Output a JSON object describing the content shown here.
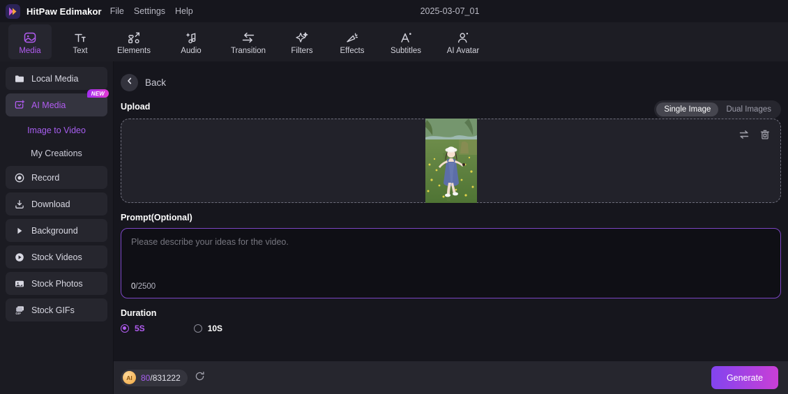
{
  "titlebar": {
    "app_title": "HitPaw Edimakor",
    "menus": [
      "File",
      "Settings",
      "Help"
    ],
    "project_name": "2025-03-07_01",
    "logo_icon": "hitpaw-play-logo-icon"
  },
  "toolbar": {
    "tabs": [
      {
        "label": "Media",
        "icon": "media-image-icon",
        "active": true
      },
      {
        "label": "Text",
        "icon": "text-icon",
        "active": false
      },
      {
        "label": "Elements",
        "icon": "elements-shapes-icon",
        "active": false
      },
      {
        "label": "Audio",
        "icon": "audio-note-icon",
        "active": false
      },
      {
        "label": "Transition",
        "icon": "transition-arrows-icon",
        "active": false
      },
      {
        "label": "Filters",
        "icon": "filters-sparkle-icon",
        "active": false
      },
      {
        "label": "Effects",
        "icon": "effects-magic-wand-icon",
        "active": false
      },
      {
        "label": "Subtitles",
        "icon": "subtitles-letter-a-icon",
        "active": false
      },
      {
        "label": "AI Avatar",
        "icon": "ai-avatar-person-icon",
        "active": false
      }
    ]
  },
  "sidebar": {
    "items": [
      {
        "label": "Local Media",
        "icon": "folder-icon",
        "type": "item",
        "active": false
      },
      {
        "label": "AI Media",
        "icon": "ai-media-icon",
        "type": "item",
        "active": true,
        "badge": "NEW"
      },
      {
        "label": "Image to Video",
        "type": "sub",
        "active": true
      },
      {
        "label": "My Creations",
        "type": "sub",
        "active": false
      },
      {
        "label": "Record",
        "icon": "record-circle-icon",
        "type": "item",
        "active": false
      },
      {
        "label": "Download",
        "icon": "download-icon",
        "type": "item",
        "active": false
      },
      {
        "label": "Background",
        "icon": "play-triangle-icon",
        "type": "item",
        "active": false
      },
      {
        "label": "Stock Videos",
        "icon": "stock-video-icon",
        "type": "item",
        "active": false
      },
      {
        "label": "Stock Photos",
        "icon": "stock-photo-icon",
        "type": "item",
        "active": false
      },
      {
        "label": "Stock GIFs",
        "icon": "stock-gif-icon",
        "type": "item",
        "active": false
      }
    ]
  },
  "main": {
    "back_label": "Back",
    "back_icon": "chevron-left-icon",
    "upload": {
      "title": "Upload",
      "modes": [
        {
          "label": "Single Image",
          "active": true
        },
        {
          "label": "Dual Images",
          "active": false
        }
      ],
      "swap_icon": "swap-arrows-icon",
      "delete_icon": "trash-icon",
      "image_alt": "girl-in-blue-dress-walking-in-flower-field"
    },
    "prompt": {
      "title": "Prompt(Optional)",
      "placeholder": "Please describe your ideas for the video.",
      "value": "",
      "count_used": "0",
      "count_max": "/2500"
    },
    "duration": {
      "title": "Duration",
      "options": [
        {
          "label": "5S",
          "checked": true
        },
        {
          "label": "10S",
          "checked": false
        }
      ]
    }
  },
  "bottombar": {
    "coin_label": "AI",
    "credits_used": "80",
    "credits_total": "/831222",
    "refresh_icon": "refresh-icon",
    "generate_label": "Generate"
  },
  "colors": {
    "accent_purple": "#b15cf0",
    "accent_magenta": "#c93fd6",
    "window_bg": "#16161d",
    "panel_bg": "#1b1b22",
    "toolbar_bg": "#1d1d24",
    "bottombar_bg": "#26262e"
  }
}
